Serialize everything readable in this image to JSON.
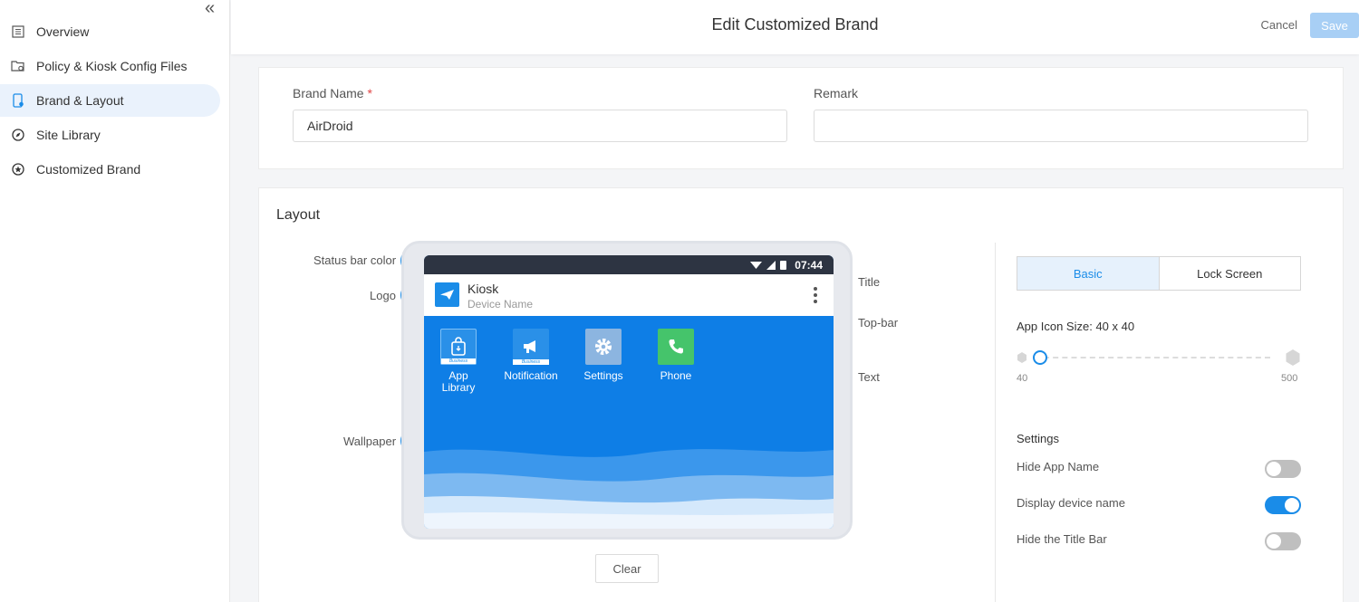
{
  "sidebar": {
    "collapse_glyph": "«",
    "items": [
      {
        "label": "Overview",
        "icon": "document-list-icon"
      },
      {
        "label": "Policy & Kiosk Config Files",
        "icon": "file-settings-icon"
      },
      {
        "label": "Brand & Layout",
        "icon": "phone-settings-icon",
        "active": true
      },
      {
        "label": "Site Library",
        "icon": "compass-icon"
      },
      {
        "label": "Customized Brand",
        "icon": "star-circle-icon"
      }
    ]
  },
  "header": {
    "title": "Edit Customized Brand",
    "cancel_label": "Cancel",
    "save_label": "Save"
  },
  "brand_form": {
    "brand_name_label": "Brand Name",
    "required_mark": "*",
    "brand_name_value": "AirDroid",
    "remark_label": "Remark",
    "remark_value": ""
  },
  "layout": {
    "title": "Layout",
    "callouts": {
      "status_bar_color": "Status bar color",
      "logo": "Logo",
      "wallpaper": "Wallpaper",
      "title": "Title",
      "top_bar": "Top-bar",
      "text": "Text"
    },
    "preview": {
      "time": "07:44",
      "kiosk_title": "Kiosk",
      "device_name": "Device Name",
      "apps": [
        {
          "name_line1": "App",
          "name_line2": "Library",
          "icon": "bag-icon"
        },
        {
          "name_line1": "Notification",
          "name_line2": "",
          "icon": "megaphone-icon"
        },
        {
          "name_line1": "Settings",
          "name_line2": "",
          "icon": "gear-icon"
        },
        {
          "name_line1": "Phone",
          "name_line2": "",
          "icon": "phone-icon"
        }
      ],
      "business_label": "Business"
    },
    "clear_label": "Clear"
  },
  "settings_panel": {
    "tabs": [
      {
        "label": "Basic",
        "active": true
      },
      {
        "label": "Lock Screen",
        "active": false
      }
    ],
    "icon_size_label": "App Icon Size: 40 x 40",
    "slider": {
      "min": "40",
      "max": "500",
      "value": 40
    },
    "settings_title": "Settings",
    "toggles": [
      {
        "label": "Hide App Name",
        "on": false
      },
      {
        "label": "Display device name",
        "on": true
      },
      {
        "label": "Hide the Title Bar",
        "on": false
      }
    ]
  },
  "colors": {
    "accent": "#1a8ce8",
    "status_bar": "#2d3442",
    "wallpaper": "#0e7ee6",
    "save_disabled": "#a8cff5"
  }
}
